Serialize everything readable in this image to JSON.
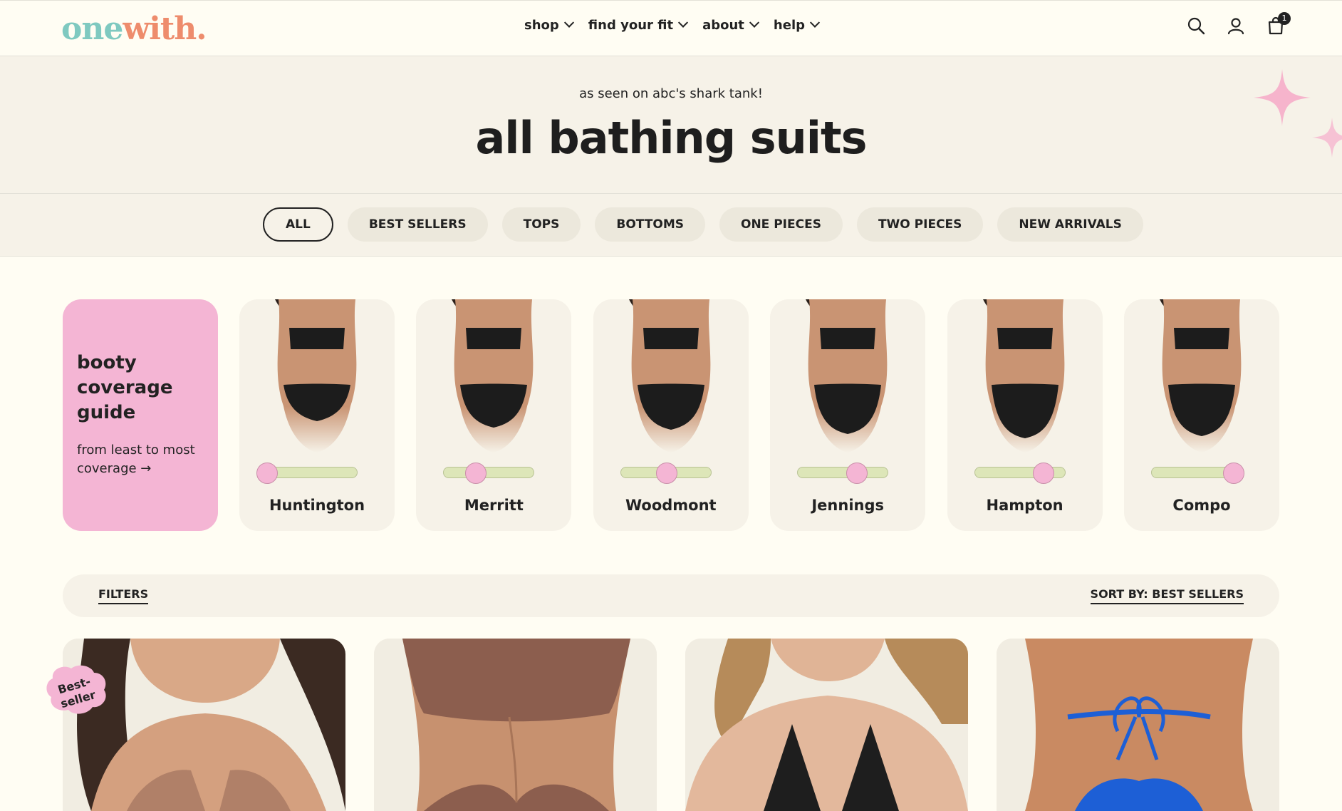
{
  "header": {
    "logo": {
      "part1": "one",
      "part2": "with",
      "dot": "."
    },
    "nav": [
      {
        "label": "shop"
      },
      {
        "label": "find your fit"
      },
      {
        "label": "about"
      },
      {
        "label": "help"
      }
    ],
    "icons": {
      "search": "search-icon",
      "account": "user-icon",
      "cart": "bag-icon"
    },
    "cart_count": "1"
  },
  "hero": {
    "subtitle": "as seen on abc's shark tank!",
    "title": "all bathing suits"
  },
  "categories": [
    {
      "label": "ALL",
      "active": true
    },
    {
      "label": "BEST SELLERS",
      "active": false
    },
    {
      "label": "TOPS",
      "active": false
    },
    {
      "label": "BOTTOMS",
      "active": false
    },
    {
      "label": "ONE PIECES",
      "active": false
    },
    {
      "label": "TWO PIECES",
      "active": false
    },
    {
      "label": "NEW ARRIVALS",
      "active": false
    }
  ],
  "coverage_guide": {
    "title": "booty coverage guide",
    "title_lines": [
      "booty",
      "coverage",
      "guide"
    ],
    "subtitle_lines": [
      "from least to most",
      "coverage →"
    ],
    "styles": [
      {
        "name": "Huntington",
        "coverage": 0.0
      },
      {
        "name": "Merritt",
        "coverage": 0.35
      },
      {
        "name": "Woodmont",
        "coverage": 0.5
      },
      {
        "name": "Jennings",
        "coverage": 0.65
      },
      {
        "name": "Hampton",
        "coverage": 0.75
      },
      {
        "name": "Compo",
        "coverage": 0.9
      }
    ]
  },
  "filter_bar": {
    "filters_label": "FILTERS",
    "sort_label": "SORT BY: BEST SELLERS"
  },
  "products": [
    {
      "image": "model wearing tan bikini top",
      "badge": "Best-seller"
    },
    {
      "image": "back view brown bikini",
      "badge": ""
    },
    {
      "image": "model wearing black triangle top",
      "badge": ""
    },
    {
      "image": "back view blue tie bikini",
      "badge": ""
    }
  ],
  "badge_lines": [
    "Best-",
    "seller"
  ],
  "colors": {
    "background": "#fffdf3",
    "panel": "#f6f2e8",
    "pink": "#f4b5d4",
    "slider_track": "#dde6b8",
    "logo_teal": "#7fc9c0",
    "logo_coral": "#ee8c6c"
  }
}
